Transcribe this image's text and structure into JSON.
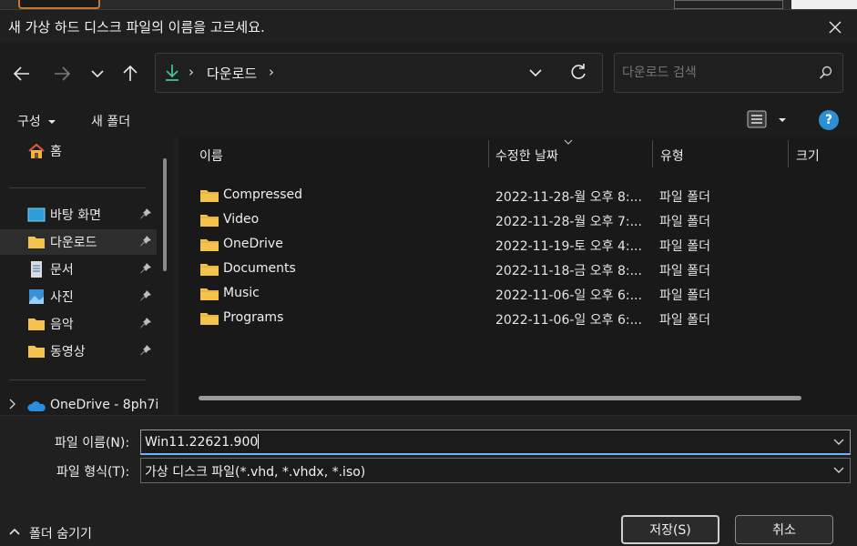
{
  "dialog": {
    "title": "새 가상 하드 디스크 파일의 이름을 고르세요."
  },
  "address": {
    "location": "다운로드",
    "search_placeholder": "다운로드 검색"
  },
  "commands": {
    "organize": "구성",
    "new_folder": "새 폴더"
  },
  "sidebar": {
    "home": "홈",
    "quick": [
      {
        "label": "바탕 화면",
        "icon": "desktop-icon"
      },
      {
        "label": "다운로드",
        "icon": "download-folder-icon"
      },
      {
        "label": "문서",
        "icon": "document-icon"
      },
      {
        "label": "사진",
        "icon": "picture-icon"
      },
      {
        "label": "음악",
        "icon": "music-folder-icon"
      },
      {
        "label": "동영상",
        "icon": "video-folder-icon"
      }
    ],
    "onedrive": "OneDrive - 8ph7i"
  },
  "columns": {
    "name": "이름",
    "modified": "수정한 날짜",
    "type": "유형",
    "size": "크기"
  },
  "files": [
    {
      "name": "Compressed",
      "modified": "2022-11-28-월 오후 8:...",
      "type": "파일 폴더"
    },
    {
      "name": "Video",
      "modified": "2022-11-28-월 오후 7:...",
      "type": "파일 폴더"
    },
    {
      "name": "OneDrive",
      "modified": "2022-11-19-토 오후 4:...",
      "type": "파일 폴더"
    },
    {
      "name": "Documents",
      "modified": "2022-11-18-금 오후 8:...",
      "type": "파일 폴더"
    },
    {
      "name": "Music",
      "modified": "2022-11-06-일 오후 6:...",
      "type": "파일 폴더"
    },
    {
      "name": "Programs",
      "modified": "2022-11-06-일 오후 6:...",
      "type": "파일 폴더"
    }
  ],
  "form": {
    "filename_label": "파일 이름(N):",
    "filename_value": "Win11.22621.900",
    "filetype_label": "파일 형식(T):",
    "filetype_value": "가상 디스크 파일(*.vhd, *.vhdx, *.iso)"
  },
  "buttons": {
    "save": "저장(S)",
    "cancel": "취소",
    "hide_folders": "폴더 숨기기"
  },
  "colors": {
    "accent": "#2c8fd6",
    "folder": "#f3c24f",
    "download_arrow": "#3fbf9a"
  }
}
